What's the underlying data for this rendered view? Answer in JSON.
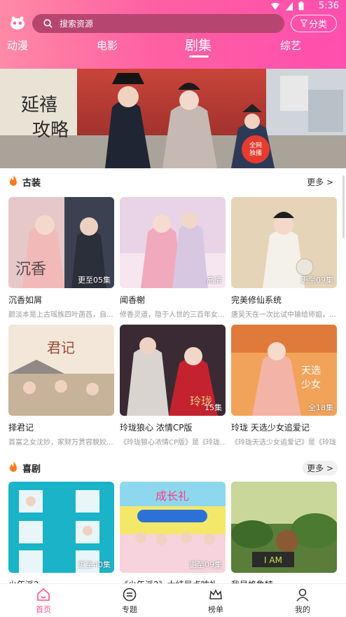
{
  "status": {
    "time": "5:36"
  },
  "search": {
    "placeholder": "搜索资源"
  },
  "filter": {
    "label": "分类"
  },
  "tabs": [
    {
      "label": "动漫"
    },
    {
      "label": "电影"
    },
    {
      "label": "剧集",
      "active": true
    },
    {
      "label": "综艺"
    }
  ],
  "sections": [
    {
      "title": "古装",
      "more": "更多 >",
      "cards": [
        {
          "title": "沉香如屑",
          "desc": "颜淡本是上古瑶族四叶菡萏，自...",
          "badge": "更至05集"
        },
        {
          "title": "闻香榭",
          "desc": "修香灵道，隐于人世的三百年女...",
          "badge": "高清"
        },
        {
          "title": "完美修仙系统",
          "desc": "唐吴天在一次比试中输给师姐，...",
          "badge": "更至09集"
        },
        {
          "title": "择君记",
          "desc": "首富之女沈妙，家财万贯容貌姣...",
          "badge": ""
        },
        {
          "title": "玲珑狼心 浓情CP版",
          "desc": "《玲珑狼心浓情CP版》是《玲珑...",
          "badge": "15集"
        },
        {
          "title": "玲珑 天选少女追爱记",
          "desc": "《玲珑天选少女追爱记》是《玲珑...",
          "badge": "全18集"
        }
      ]
    },
    {
      "title": "喜剧",
      "more": "更多 >",
      "cards": [
        {
          "title": "少年派2",
          "desc": "",
          "badge": "更至40集"
        },
        {
          "title": "《少年派2》大结局点映礼",
          "desc": "",
          "badge": "更至09集"
        },
        {
          "title": "我是格鲁特",
          "desc": "",
          "badge": ""
        }
      ]
    }
  ],
  "banner": {
    "poster_title": "延禧攻略",
    "badge": "全网独播"
  },
  "bottom_nav": [
    {
      "label": "首页",
      "icon": "home-icon",
      "active": true
    },
    {
      "label": "专题",
      "icon": "topic-icon"
    },
    {
      "label": "榜单",
      "icon": "crown-icon"
    },
    {
      "label": "我的",
      "icon": "user-icon"
    }
  ],
  "colors": {
    "accent": "#ff4f8f",
    "topbar": "#ff5fa2",
    "search_bg": "#b6466f"
  }
}
